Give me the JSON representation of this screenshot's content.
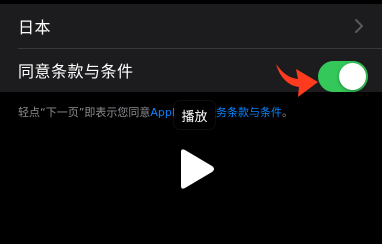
{
  "settings": {
    "region_label": "日本",
    "terms_label": "同意条款与条件",
    "terms_toggle_on": true,
    "toggle_color": "#34c759"
  },
  "footer": {
    "prefix": "轻点“下一页”即表示您同意",
    "link_start": "Appl",
    "link_end": "服务条款与条件",
    "suffix": "。"
  },
  "tooltip": {
    "label": "播放"
  },
  "icons": {
    "chevron": "chevron-right-icon",
    "arrow": "red-arrow-icon",
    "play": "play-icon"
  },
  "colors": {
    "background": "#000000",
    "cell": "#1c1c1e",
    "link": "#0a84ff",
    "arrow": "#ff3b1f"
  }
}
